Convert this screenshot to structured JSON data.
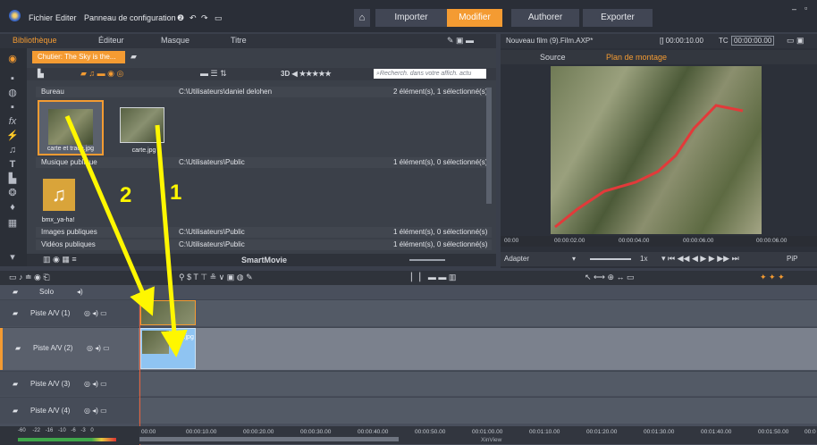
{
  "app": {
    "menus": [
      "Fichier",
      "Editer",
      "Panneau de configuration"
    ],
    "mode_buttons": [
      "Importer",
      "Modifier",
      "Authorer",
      "Exporter"
    ]
  },
  "library": {
    "tabs": [
      "Bibliothèque",
      "Éditeur",
      "Masque",
      "Titre"
    ],
    "chutier_label": "Chutier: The Sky is the...",
    "search_placeholder": "Recherch. dans votre affich. actu",
    "rows": [
      {
        "name": "Bureau",
        "path": "C:\\Utilisateurs\\daniel delohen",
        "info": "2 élément(s), 1 sélectionné(s)"
      },
      {
        "name": "Musique publique",
        "path": "C:\\Utilisateurs\\Public",
        "info": "1 élément(s), 0 sélectionné(s)"
      },
      {
        "name": "Images publiques",
        "path": "C:\\Utilisateurs\\Public",
        "info": "1 élément(s), 0 sélectionné(s)"
      },
      {
        "name": "Vidéos publiques",
        "path": "C:\\Utilisateurs\\Public",
        "info": "1 élément(s), 0 sélectionné(s)"
      }
    ],
    "media_items": [
      "carte et trace.jpg",
      "carte.jpg",
      "bmx_ya-ha!"
    ],
    "bottom_label": "SmartMovie"
  },
  "preview": {
    "title": "Nouveau film (9).Film.AXP*",
    "timecode": "[] 00:00:10.00",
    "tc_label": "TC",
    "tc_value": "00:00:00.00",
    "tabs": [
      "Source",
      "Plan de montage"
    ],
    "ticks": [
      "00:00",
      "00:00:02.00",
      "00:00:04.00",
      "00:00:06.00",
      "00:00:06.00"
    ],
    "fit_label": "Adapter",
    "speed_label": "1x",
    "pip_label": "PiP"
  },
  "timeline": {
    "solo_label": "Solo",
    "tracks": [
      "Piste A/V (1)",
      "Piste A/V (2)",
      "Piste A/V (3)",
      "Piste A/V (4)"
    ],
    "clip_label": "carte.jpg",
    "ruler_ticks": [
      "00:00",
      "00:00:10.00",
      "00:00:20.00",
      "00:00:30.00",
      "00:00:40.00",
      "00:00:50.00",
      "00:01:00.00",
      "00:01:10.00",
      "00:01:20.00",
      "00:01:30.00",
      "00:01:40.00",
      "00:01:50.00",
      "00:0"
    ],
    "audio_scale": [
      "-60",
      "-22",
      "-16",
      "-10",
      "-6",
      "-3",
      "0"
    ],
    "xinview_label": "XinView"
  },
  "annotations": {
    "arrow_1": "1",
    "arrow_2": "2"
  },
  "colors": {
    "accent": "#f49b32",
    "clip_blue": "#8fc4f2",
    "arrow_yellow": "#fff700"
  }
}
